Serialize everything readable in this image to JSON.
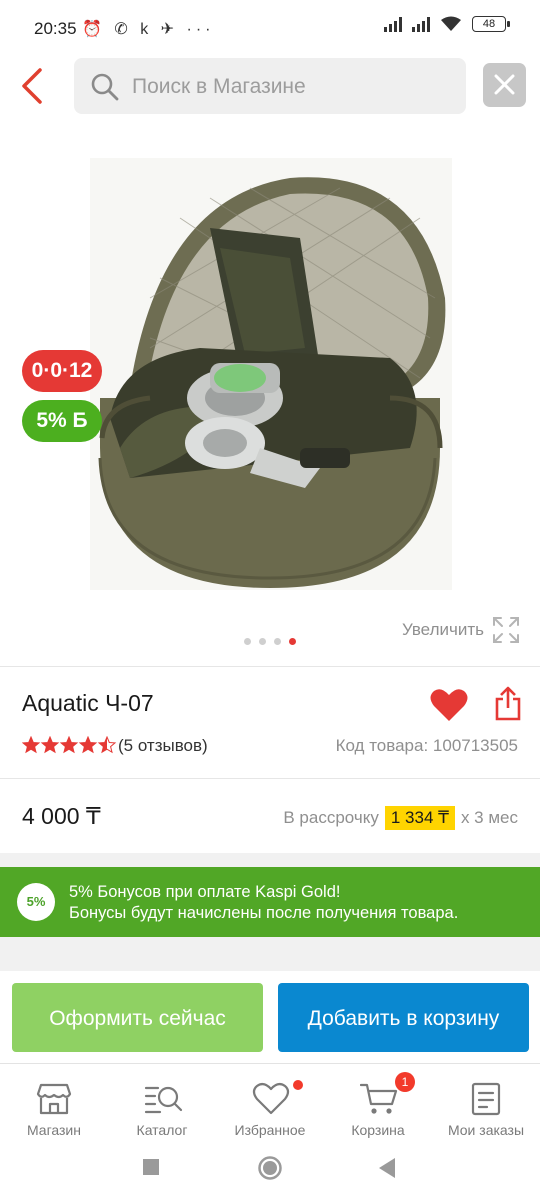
{
  "status_bar": {
    "time": "20:35",
    "notification_icons": "⏰ ✆ k ✈ ···",
    "battery": "48"
  },
  "search": {
    "placeholder": "Поиск в Магазине"
  },
  "gallery": {
    "badge_installment": "0·0·12",
    "badge_bonus": "5% Б",
    "zoom_label": "Увеличить",
    "image_count": 4,
    "active_image": 4
  },
  "product": {
    "title": "Aquatic Ч-07",
    "rating": 4.5,
    "rating_max": 5,
    "reviews": "(5 отзывов)",
    "code": "Код товара: 100713505",
    "price": "4 000 ₸",
    "installment_prefix": "В рассрочку",
    "installment_amount": "1 334 ₸",
    "installment_suffix": "x 3 мес"
  },
  "bonus": {
    "circle": "5%",
    "line1": "5% Бонусов при оплате Kaspi Gold!",
    "line2": "Бонусы будут начислены после получения товара."
  },
  "actions": {
    "checkout": "Оформить сейчас",
    "add_to_cart": "Добавить в корзину"
  },
  "nav": {
    "items": [
      {
        "label": "Магазин",
        "icon": "shop-icon"
      },
      {
        "label": "Каталог",
        "icon": "catalog-search-icon"
      },
      {
        "label": "Избранное",
        "icon": "heart-icon"
      },
      {
        "label": "Корзина",
        "icon": "cart-icon",
        "badge": "1"
      },
      {
        "label": "Мои заказы",
        "icon": "orders-icon"
      }
    ]
  },
  "colors": {
    "accent_red": "#e53935",
    "bonus_green": "#51a726",
    "checkout_green": "#8fd163",
    "cart_blue": "#0a88d0",
    "installment_yellow": "#ffd400"
  }
}
